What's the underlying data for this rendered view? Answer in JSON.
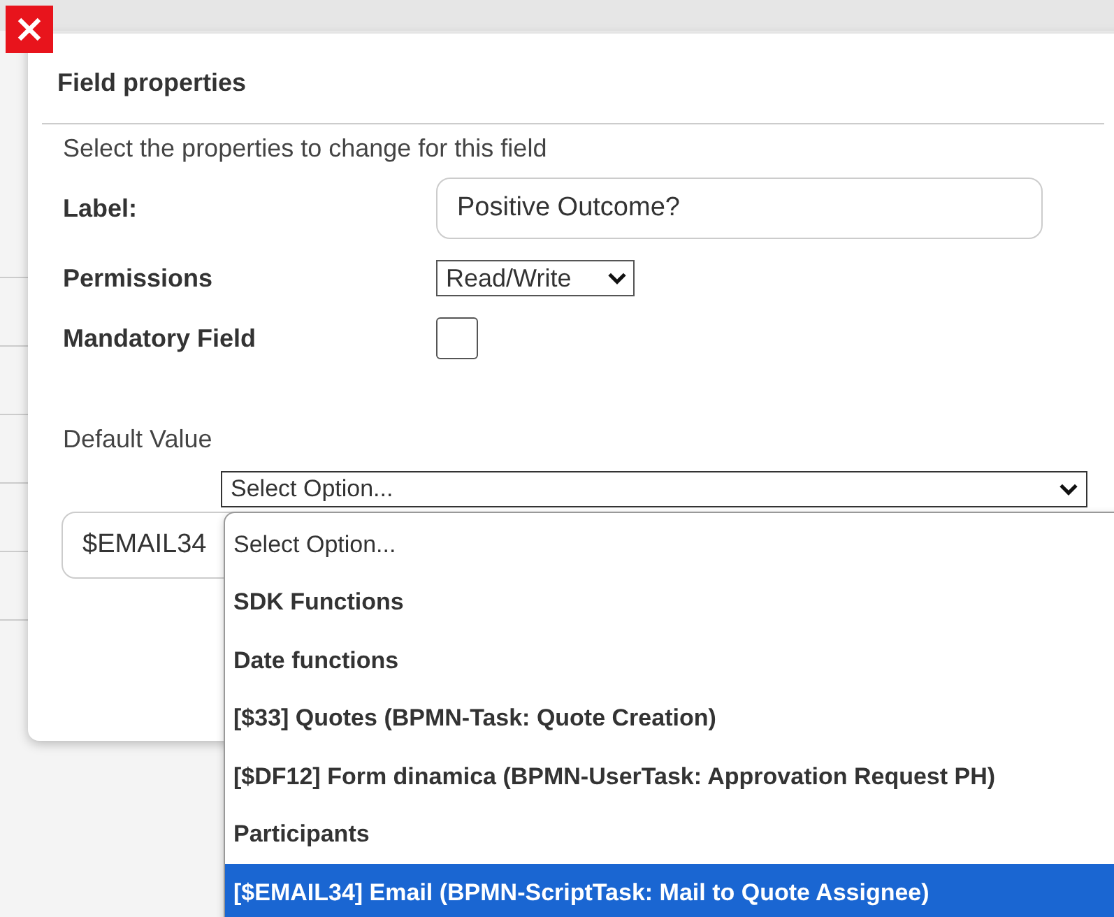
{
  "dialog": {
    "title": "Field properties",
    "instructions": "Select the properties to change for this field",
    "label": {
      "caption": "Label:",
      "value": "Positive Outcome?"
    },
    "permissions": {
      "caption": "Permissions",
      "value": "Read/Write"
    },
    "mandatory": {
      "caption": "Mandatory Field",
      "checked": false
    },
    "default_value": {
      "caption": "Default Value",
      "select_value": "Select Option...",
      "value": "$EMAIL34"
    }
  },
  "dropdown": {
    "options": [
      {
        "label": "Select Option...",
        "kind": "placeholder",
        "selected": false
      },
      {
        "label": "SDK Functions",
        "kind": "option",
        "selected": false
      },
      {
        "label": "Date functions",
        "kind": "option",
        "selected": false
      },
      {
        "label": "[$33] Quotes (BPMN-Task: Quote Creation)",
        "kind": "option",
        "selected": false
      },
      {
        "label": "[$DF12] Form dinamica (BPMN-UserTask: Approvation Request PH)",
        "kind": "option",
        "selected": false
      },
      {
        "label": "Participants",
        "kind": "option",
        "selected": false
      },
      {
        "label": "[$EMAIL34] Email (BPMN-ScriptTask: Mail to Quote Assignee)",
        "kind": "option",
        "selected": true
      }
    ]
  }
}
